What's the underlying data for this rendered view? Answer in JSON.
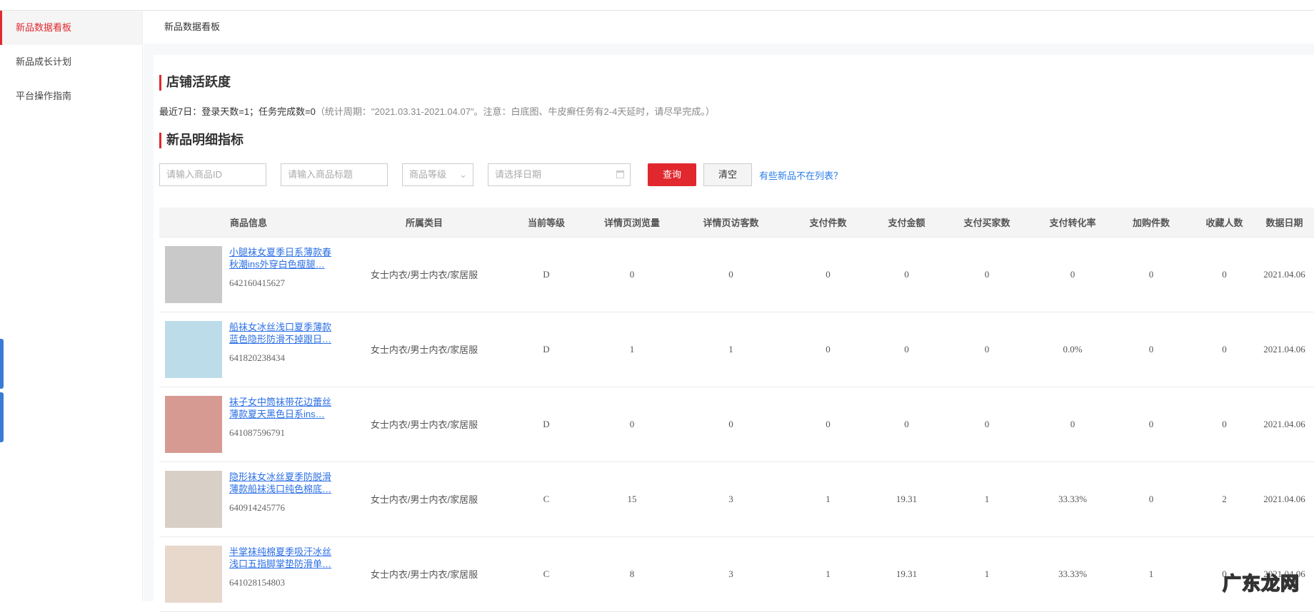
{
  "sidebar": {
    "items": [
      {
        "label": "新品数据看板"
      },
      {
        "label": "新品成长计划"
      },
      {
        "label": "平台操作指南"
      }
    ]
  },
  "breadcrumb": "新品数据看板",
  "activity": {
    "title": "店铺活跃度",
    "stats": "最近7日：登录天数=1；任务完成数=0",
    "note": "（统计周期：\"2021.03.31-2021.04.07\"。注意：白底图、牛皮癣任务有2-4天延时，请尽早完成。）"
  },
  "detail": {
    "title": "新品明细指标"
  },
  "filters": {
    "id_placeholder": "请输入商品ID",
    "title_placeholder": "请输入商品标题",
    "level_select": "商品等级",
    "date_placeholder": "请选择日期",
    "query": "查询",
    "clear": "清空",
    "help_link": "有些新品不在列表？"
  },
  "table": {
    "headers": [
      "商品信息",
      "所属类目",
      "当前等级",
      "详情页浏览量",
      "详情页访客数",
      "支付件数",
      "支付金额",
      "支付买家数",
      "支付转化率",
      "加购件数",
      "收藏人数",
      "数据日期"
    ],
    "rows": [
      {
        "title": "小腿袜女夏季日系薄款春秋潮ins外穿白色瘦腿…",
        "id": "642160415627",
        "category": "女士内衣/男士内衣/家居服",
        "level": "D",
        "pv": "0",
        "uv": "0",
        "pay_items": "0",
        "pay_amount": "0",
        "buyers": "0",
        "cvr": "0",
        "cart": "0",
        "fav": "0",
        "date": "2021.04.06",
        "thumb": "#c9c9c9"
      },
      {
        "title": "船袜女冰丝浅口夏季薄款蓝色隐形防滑不掉跟日…",
        "id": "641820238434",
        "category": "女士内衣/男士内衣/家居服",
        "level": "D",
        "pv": "1",
        "uv": "1",
        "pay_items": "0",
        "pay_amount": "0",
        "buyers": "0",
        "cvr": "0.0%",
        "cart": "0",
        "fav": "0",
        "date": "2021.04.06",
        "thumb": "#bcdcea"
      },
      {
        "title": "袜子女中筒袜带花边蕾丝薄款夏天黑色日系ins…",
        "id": "641087596791",
        "category": "女士内衣/男士内衣/家居服",
        "level": "D",
        "pv": "0",
        "uv": "0",
        "pay_items": "0",
        "pay_amount": "0",
        "buyers": "0",
        "cvr": "0",
        "cart": "0",
        "fav": "0",
        "date": "2021.04.06",
        "thumb": "#d79a92"
      },
      {
        "title": "隐形袜女冰丝夏季防脱滑薄款船袜浅口纯色棉底…",
        "id": "640914245776",
        "category": "女士内衣/男士内衣/家居服",
        "level": "C",
        "pv": "15",
        "uv": "3",
        "pay_items": "1",
        "pay_amount": "19.31",
        "buyers": "1",
        "cvr": "33.33%",
        "cart": "0",
        "fav": "2",
        "date": "2021.04.06",
        "thumb": "#d8cfc6"
      },
      {
        "title": "半掌袜纯棉夏季吸汗冰丝浅口五指脚掌垫防滑单…",
        "id": "641028154803",
        "category": "女士内衣/男士内衣/家居服",
        "level": "C",
        "pv": "8",
        "uv": "3",
        "pay_items": "1",
        "pay_amount": "19.31",
        "buyers": "1",
        "cvr": "33.33%",
        "cart": "1",
        "fav": "0",
        "date": "2021.04.06",
        "thumb": "#e8d8cc"
      }
    ]
  },
  "watermark": "广东龙网"
}
